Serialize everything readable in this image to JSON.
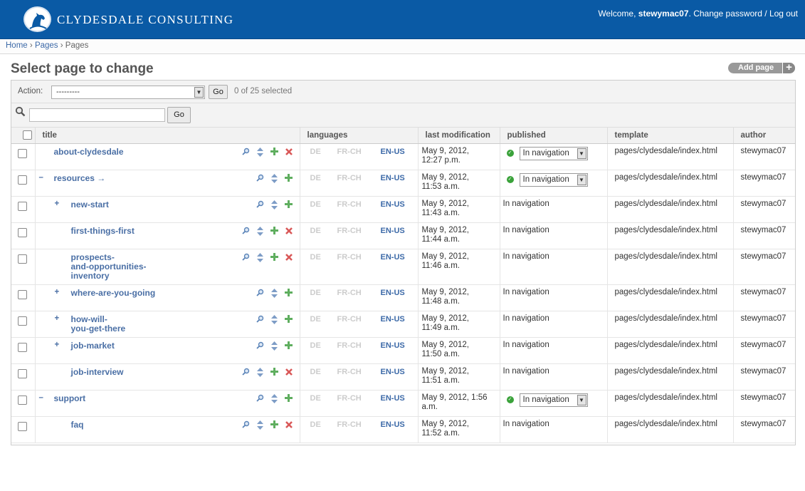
{
  "header": {
    "brand": "CLYDESDALE CONSULTING",
    "welcome_prefix": "Welcome,",
    "username": "stewymac07",
    "change_password": "Change password",
    "sep": "/",
    "logout": "Log out"
  },
  "breadcrumbs": {
    "home": "Home",
    "pages_link": "Pages",
    "current": "Pages",
    "sep": "›"
  },
  "page_title": "Select page to change",
  "add_page": "Add page",
  "actions": {
    "label": "Action:",
    "select_value": "---------",
    "go": "Go",
    "counter": "0 of 25 selected"
  },
  "search": {
    "go": "Go",
    "value": ""
  },
  "columns": {
    "title": "title",
    "languages": "languages",
    "last_modification": "last modification",
    "published": "published",
    "template": "template",
    "author": "author"
  },
  "language_codes": {
    "de": "DE",
    "fr": "FR-CH",
    "en": "EN-US"
  },
  "rows": [
    {
      "toggle": "",
      "title": "about-clydesdale",
      "delete": true,
      "modified": [
        "May 9, 2012,",
        "12:27 p.m."
      ],
      "published_type": "select",
      "published": "In navigation",
      "template": "pages/clydesdale/index.html",
      "author": "stewymac07"
    },
    {
      "toggle": "–",
      "title": "resources →",
      "delete": false,
      "modified": [
        "May 9, 2012,",
        "11:53 a.m."
      ],
      "published_type": "select",
      "published": "In navigation",
      "template": "pages/clydesdale/index.html",
      "author": "stewymac07"
    },
    {
      "toggle": "+",
      "title": "new-start",
      "delete": false,
      "modified": [
        "May 9, 2012,",
        "11:43 a.m."
      ],
      "published_type": "text",
      "published": "In navigation",
      "template": "pages/clydesdale/index.html",
      "author": "stewymac07"
    },
    {
      "toggle": "",
      "title": "first-things-first",
      "delete": true,
      "modified": [
        "May 9, 2012,",
        "11:44 a.m."
      ],
      "published_type": "text",
      "published": "In navigation",
      "template": "pages/clydesdale/index.html",
      "author": "stewymac07"
    },
    {
      "toggle": "",
      "title": "prospects-\nand-opportunities-\ninventory",
      "delete": true,
      "modified": [
        "May 9, 2012,",
        "11:46 a.m."
      ],
      "published_type": "text",
      "published": "In navigation",
      "template": "pages/clydesdale/index.html",
      "author": "stewymac07"
    },
    {
      "toggle": "+",
      "title": "where-are-you-going",
      "delete": false,
      "modified": [
        "May 9, 2012,",
        "11:48 a.m."
      ],
      "published_type": "text",
      "published": "In navigation",
      "template": "pages/clydesdale/index.html",
      "author": "stewymac07"
    },
    {
      "toggle": "+",
      "title": "how-will-\nyou-get-there",
      "delete": false,
      "modified": [
        "May 9, 2012,",
        "11:49 a.m."
      ],
      "published_type": "text",
      "published": "In navigation",
      "template": "pages/clydesdale/index.html",
      "author": "stewymac07"
    },
    {
      "toggle": "+",
      "title": "job-market",
      "delete": false,
      "modified": [
        "May 9, 2012,",
        "11:50 a.m."
      ],
      "published_type": "text",
      "published": "In navigation",
      "template": "pages/clydesdale/index.html",
      "author": "stewymac07"
    },
    {
      "toggle": "",
      "title": "job-interview",
      "delete": true,
      "modified": [
        "May 9, 2012,",
        "11:51 a.m."
      ],
      "published_type": "text",
      "published": "In navigation",
      "template": "pages/clydesdale/index.html",
      "author": "stewymac07"
    },
    {
      "toggle": "–",
      "title": "support",
      "delete": false,
      "modified": [
        "May 9, 2012, 1:56",
        "a.m."
      ],
      "published_type": "select",
      "published": "In navigation",
      "template": "pages/clydesdale/index.html",
      "author": "stewymac07"
    },
    {
      "toggle": "",
      "title": "faq",
      "delete": true,
      "modified": [
        "May 9, 2012,",
        "11:52 a.m."
      ],
      "published_type": "text",
      "published": "In navigation",
      "template": "pages/clydesdale/index.html",
      "author": "stewymac07"
    }
  ]
}
